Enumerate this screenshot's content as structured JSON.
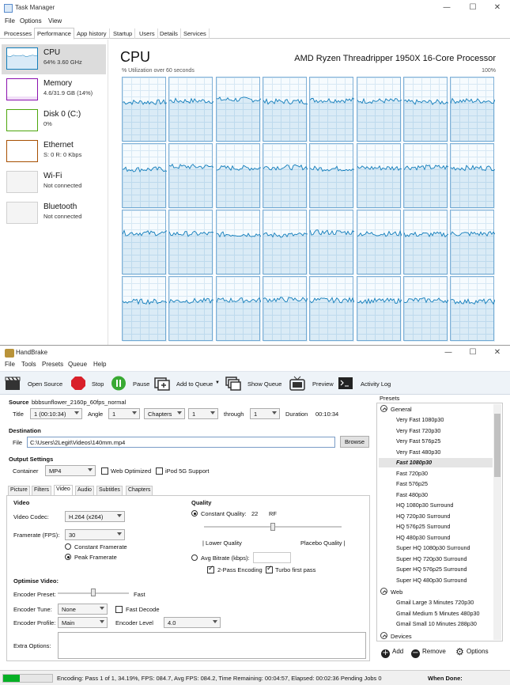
{
  "task_manager": {
    "window_title": "Task Manager",
    "menu": [
      "File",
      "Options",
      "View"
    ],
    "tabs": [
      "Processes",
      "Performance",
      "App history",
      "Startup",
      "Users",
      "Details",
      "Services"
    ],
    "active_tab": "Performance",
    "resources": [
      {
        "name": "CPU",
        "sub": "64%  3.60 GHz",
        "color": "#117dbb",
        "selected": true
      },
      {
        "name": "Memory",
        "sub": "4.6/31.9 GB (14%)",
        "color": "#8b12ae",
        "selected": false
      },
      {
        "name": "Disk 0 (C:)",
        "sub": "0%",
        "color": "#4da60c",
        "selected": false
      },
      {
        "name": "Ethernet",
        "sub": "S: 0  R: 0 Kbps",
        "color": "#a74f01",
        "selected": false
      },
      {
        "name": "Wi-Fi",
        "sub": "Not connected",
        "color": "#bbbbbb",
        "selected": false
      },
      {
        "name": "Bluetooth",
        "sub": "Not connected",
        "color": "#bbbbbb",
        "selected": false
      }
    ],
    "cpu": {
      "title": "CPU",
      "model": "AMD Ryzen Threadripper 1950X 16-Core Processor",
      "util_label": "% Utilization over 60 seconds",
      "max_label": "100%",
      "graph_color": "#117dbb",
      "logical_processor_count": 32,
      "core_levels": [
        0.62,
        0.64,
        0.66,
        0.63,
        0.65,
        0.64,
        0.62,
        0.64,
        0.61,
        0.65,
        0.63,
        0.64,
        0.62,
        0.63,
        0.64,
        0.63,
        0.65,
        0.64,
        0.63,
        0.62,
        0.66,
        0.64,
        0.63,
        0.64,
        0.62,
        0.63,
        0.64,
        0.65,
        0.64,
        0.63,
        0.64,
        0.62
      ]
    }
  },
  "handbrake": {
    "window_title": "HandBrake",
    "menu": [
      "File",
      "Tools",
      "Presets",
      "Queue",
      "Help"
    ],
    "toolbar": {
      "open_source": "Open Source",
      "stop": "Stop",
      "pause": "Pause",
      "add_to_queue": "Add to Queue",
      "show_queue": "Show Queue",
      "preview": "Preview",
      "activity_log": "Activity Log"
    },
    "source": {
      "label": "Source",
      "name": "bbbsunflower_2160p_60fps_normal",
      "title_label": "Title",
      "title_value": "1 (00:10:34)",
      "angle_label": "Angle",
      "angle_value": "1",
      "range_type": "Chapters",
      "range_start": "1",
      "through_label": "through",
      "range_end": "1",
      "duration_label": "Duration",
      "duration_value": "00:10:34"
    },
    "destination": {
      "label": "Destination",
      "file_label": "File",
      "file_value": "C:\\Users\\2Legit\\Videos\\140mm.mp4",
      "browse": "Browse"
    },
    "output": {
      "label": "Output Settings",
      "container_label": "Container",
      "container_value": "MP4",
      "web_optimized": "Web Optimized",
      "ipod": "iPod 5G Support"
    },
    "tabs": [
      "Picture",
      "Filters",
      "Video",
      "Audio",
      "Subtitles",
      "Chapters"
    ],
    "active_tab": "Video",
    "video": {
      "section": "Video",
      "codec_label": "Video Codec:",
      "codec_value": "H.264 (x264)",
      "fps_label": "Framerate (FPS):",
      "fps_value": "30",
      "constant_framerate": "Constant Framerate",
      "peak_framerate": "Peak Framerate"
    },
    "quality": {
      "section": "Quality",
      "cq_label": "Constant Quality:",
      "cq_value": "22",
      "rf": "RF",
      "slider_level": 0.5,
      "lower": "| Lower Quality",
      "higher": "Placebo Quality |",
      "avg_bitrate": "Avg Bitrate (kbps):",
      "two_pass": "2-Pass Encoding",
      "turbo": "Turbo first pass"
    },
    "optimise": {
      "section": "Optimise Video:",
      "preset_label": "Encoder Preset:",
      "preset_value": "Fast",
      "preset_level": 0.5,
      "tune_label": "Encoder Tune:",
      "tune_value": "None",
      "fast_decode": "Fast Decode",
      "profile_label": "Encoder Profile:",
      "profile_value": "Main",
      "level_label": "Encoder Level",
      "level_value": "4.0",
      "extra_label": "Extra Options:"
    },
    "presets": {
      "label": "Presets",
      "general": "General",
      "general_items": [
        "Very Fast 1080p30",
        "Very Fast 720p30",
        "Very Fast 576p25",
        "Very Fast 480p30",
        "Fast 1080p30",
        "Fast 720p30",
        "Fast 576p25",
        "Fast 480p30",
        "HQ 1080p30 Surround",
        "HQ 720p30 Surround",
        "HQ 576p25 Surround",
        "HQ 480p30 Surround",
        "Super HQ 1080p30 Surround",
        "Super HQ 720p30 Surround",
        "Super HQ 576p25 Surround",
        "Super HQ 480p30 Surround"
      ],
      "selected": "Fast 1080p30",
      "web": "Web",
      "web_items": [
        "Gmail Large 3 Minutes 720p30",
        "Gmail Medium 5 Minutes 480p30",
        "Gmail Small 10 Minutes 288p30"
      ],
      "devices": "Devices",
      "add": "Add",
      "remove": "Remove",
      "options": "Options"
    },
    "status": {
      "progress": 0.3419,
      "text": "Encoding: Pass 1 of 1,  34.19%, FPS: 084.7,  Avg FPS: 084.2,  Time Remaining: 00:04:57,  Elapsed: 00:02:36   Pending Jobs 0",
      "when_done": "When Done:"
    }
  }
}
